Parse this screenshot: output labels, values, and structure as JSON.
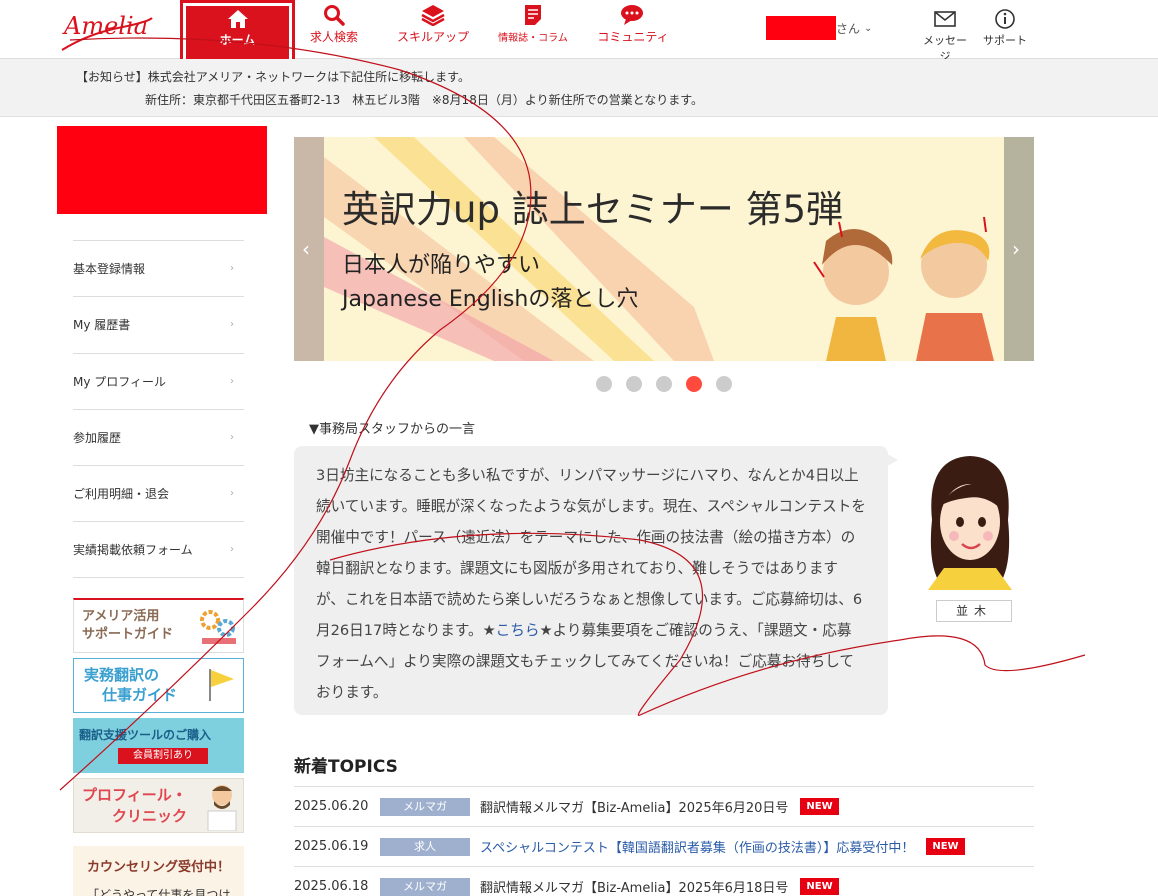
{
  "header": {
    "logo_text": "Amelia",
    "nav": [
      {
        "label": "ホーム",
        "icon": "home-icon"
      },
      {
        "label": "求人検索",
        "icon": "search-icon"
      },
      {
        "label": "スキルアップ",
        "icon": "layers-icon"
      },
      {
        "label": "情報誌・コラム",
        "icon": "document-icon"
      },
      {
        "label": "コミュニティ",
        "icon": "chat-icon"
      }
    ],
    "user_suffix": "さん",
    "utilities": [
      {
        "label": "メッセージ",
        "icon": "mail-icon"
      },
      {
        "label": "サポート",
        "icon": "info-icon"
      }
    ]
  },
  "notice": {
    "line1": "【お知らせ】株式会社アメリア・ネットワークは下記住所に移転します。",
    "line2": "新住所：東京都千代田区五番町2-13　林五ビル3階　※8月18日（月）より新住所での営業となります。"
  },
  "sidebar": {
    "menu": [
      "基本登録情報",
      "My 履歴書",
      "My プロフィール",
      "参加履歴",
      "ご利用明細・退会",
      "実績掲載依頼フォーム"
    ],
    "banners": [
      {
        "l1": "アメリア活用",
        "l2": "サポートガイド"
      },
      {
        "l1": "実務翻訳の",
        "l2": "仕事ガイド"
      },
      {
        "l1": "翻訳支援ツールのご購入",
        "l2": "会員割引あり"
      },
      {
        "l1": "プロフィール・",
        "l2": "クリニック"
      },
      {
        "l1": "カウンセリング受付中！",
        "l2": "「どうやって仕事を見つけ"
      }
    ]
  },
  "carousel": {
    "title": "英訳力up 誌上セミナー 第5弾",
    "sub1": "日本人が陥りやすい",
    "sub2": "Japanese Englishの落とし穴",
    "dots": 5,
    "active_index": 3
  },
  "staff": {
    "heading": "▼事務局スタッフからの一言",
    "text_before": "3日坊主になることも多い私ですが、リンパマッサージにハマり、なんとか4日以上続いています。睡眠が深くなったような気がします。現在、スペシャルコンテストを開催中です！パース（遠近法）をテーマにした、作画の技法書（絵の描き方本）の韓日翻訳となります。課題文にも図版が多用されており、難しそうではありますが、これを日本語で読めたら楽しいだろうなぁと想像しています。ご応募締切は、6月26日17時となります。★",
    "link": "こちら",
    "text_after": "★より募集要項をご確認のうえ、「課題文・応募フォームへ」より実際の課題文もチェックしてみてくださいね！ご応募お待ちしております。",
    "name": "並木"
  },
  "topics": {
    "title": "新着TOPICS",
    "rows": [
      {
        "date": "2025.06.20",
        "category": "メルマガ",
        "title": "翻訳情報メルマガ【Biz-Amelia】2025年6月20日号",
        "badge": "NEW",
        "link": false
      },
      {
        "date": "2025.06.19",
        "category": "求人",
        "title": "スペシャルコンテスト【韓国語翻訳者募集（作画の技法書）】応募受付中！",
        "badge": "NEW",
        "link": true
      },
      {
        "date": "2025.06.18",
        "category": "メルマガ",
        "title": "翻訳情報メルマガ【Biz-Amelia】2025年6月18日号",
        "badge": "NEW",
        "link": false
      }
    ]
  },
  "colors": {
    "brand": "#d9121d",
    "category": "#9fb0cf",
    "link": "#2a5ba8"
  }
}
